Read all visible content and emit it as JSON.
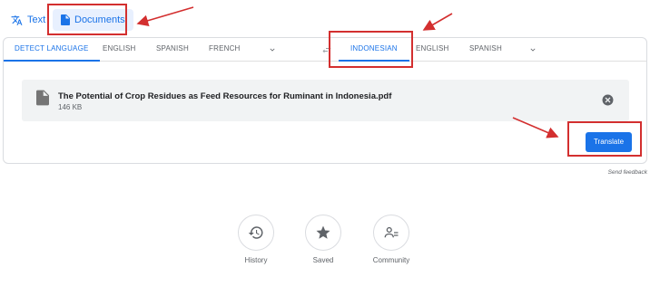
{
  "mode_tabs": {
    "text_label": "Text",
    "documents_label": "Documents"
  },
  "source_languages": [
    "DETECT LANGUAGE",
    "ENGLISH",
    "SPANISH",
    "FRENCH"
  ],
  "target_languages": [
    "INDONESIAN",
    "ENGLISH",
    "SPANISH"
  ],
  "file": {
    "name": "The Potential of Crop Residues as Feed Resources for Ruminant in Indonesia.pdf",
    "size": "146 KB"
  },
  "translate_label": "Translate",
  "feedback_label": "Send feedback",
  "shortcuts": {
    "history": "History",
    "saved": "Saved",
    "community": "Community"
  },
  "colors": {
    "accent": "#1a73e8",
    "annotation": "#d32f2f"
  }
}
